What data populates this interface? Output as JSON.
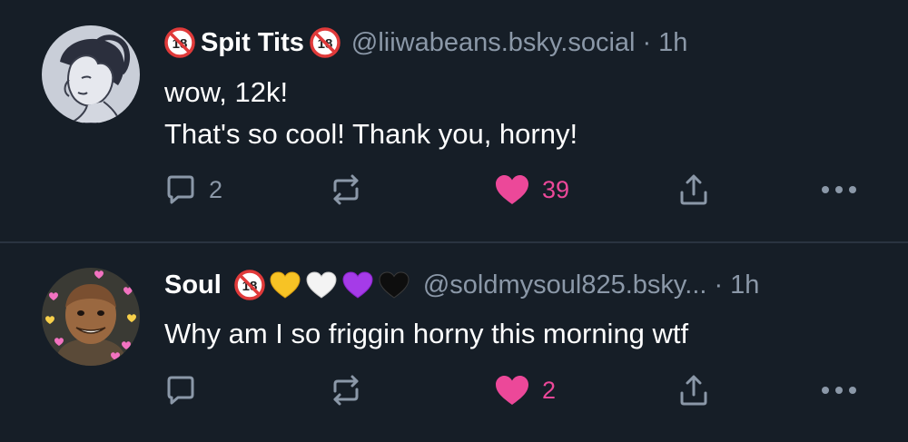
{
  "colors": {
    "background": "#161e27",
    "text": "#ffffff",
    "muted": "#8b98a8",
    "like_pink": "#ec4899",
    "divider": "#2a3440"
  },
  "posts": [
    {
      "display_name": "Spit Tits",
      "name_badges": [
        "no-under-18-icon",
        "no-under-18-icon"
      ],
      "handle": "@liiwabeans.bsky.social",
      "separator": "·",
      "time": "1h",
      "text_lines": [
        "wow, 12k!",
        "That's so cool! Thank you, horny!"
      ],
      "replies": "2",
      "likes": "39",
      "liked": true
    },
    {
      "display_name": "Soul",
      "name_badges": [
        "no-under-18-icon",
        "yellow-heart-icon",
        "white-heart-icon",
        "purple-heart-icon",
        "black-heart-icon"
      ],
      "handle": "@soldmysoul825.bsky...",
      "separator": "·",
      "time": "1h",
      "text_lines": [
        "Why am I so friggin horny this morning wtf"
      ],
      "replies": "",
      "likes": "2",
      "liked": true
    }
  ]
}
